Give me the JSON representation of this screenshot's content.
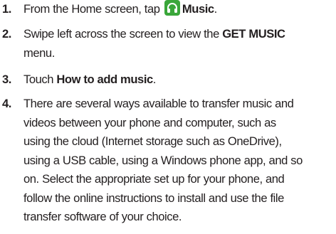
{
  "steps": [
    {
      "number": "1.",
      "lines": [
        {
          "pre": "From the Home screen, tap ",
          "bold": "Music",
          "post": "."
        }
      ],
      "icon": "headphones-icon",
      "icon_color": "#3aa63a"
    },
    {
      "number": "2.",
      "lines": [
        {
          "pre": "Swipe left across the screen to view the ",
          "bold": "GET MUSIC",
          "post": ""
        },
        {
          "text": "menu."
        }
      ]
    },
    {
      "number": "3.",
      "lines": [
        {
          "pre": "Touch ",
          "bold": "How to add music",
          "post": "."
        }
      ]
    },
    {
      "number": "4.",
      "lines": [
        {
          "text": "There are several ways available to transfer music and"
        },
        {
          "text": "videos between your phone and computer, such as"
        },
        {
          "text": "using the cloud (Internet storage such as OneDrive),"
        },
        {
          "text": "using a USB cable, using a Windows phone app, and so"
        },
        {
          "text": "on. Select the appropriate set up for your phone, and"
        },
        {
          "text": "follow the online instructions to install and use the file"
        },
        {
          "text": "transfer software of your choice."
        }
      ]
    }
  ]
}
